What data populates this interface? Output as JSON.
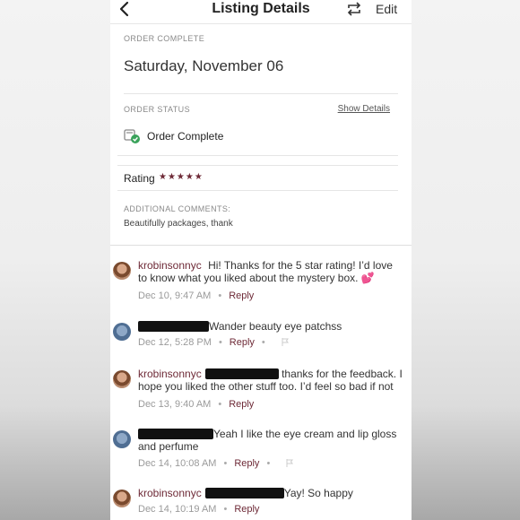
{
  "header": {
    "title": "Listing Details",
    "edit_label": "Edit"
  },
  "order": {
    "section_label": "ORDER COMPLETE",
    "date": "Saturday, November 06",
    "status_label": "ORDER STATUS",
    "show_details": "Show Details",
    "status_text": "Order Complete",
    "rating_label": "Rating",
    "rating_stars": "★★★★★",
    "rating_value": 5,
    "comments_label": "ADDITIONAL COMMENTS:",
    "comments_text": "Beautifully packages, thank"
  },
  "thread": [
    {
      "username": "krobinsonnyc",
      "line1": "Hi! Thanks for the 5 star rating! I’d love",
      "line2": "to know what you liked about the mystery box.",
      "emoji": "💕",
      "time": "Dec 10, 9:47 AM",
      "reply": "Reply"
    },
    {
      "text": "Wander beauty eye patchss",
      "time": "Dec 12, 5:28 PM",
      "reply": "Reply"
    },
    {
      "username": "krobinsonnyc",
      "line1": "thanks for the feedback. I",
      "line2": "hope you liked the other stuff too. I’d feel so bad if not",
      "time": "Dec 13, 9:40 AM",
      "reply": "Reply"
    },
    {
      "line1": "Yeah I like the eye cream and lip gloss",
      "line2": "and perfume",
      "time": "Dec 14, 10:08 AM",
      "reply": "Reply"
    },
    {
      "username": "krobinsonnyc",
      "line1": "Yay! So happy",
      "time": "Dec 14, 10:19 AM",
      "reply": "Reply"
    }
  ],
  "colors": {
    "accent": "#6e2a37",
    "status_green": "#3aa35b"
  },
  "icons": [
    "back-chevron",
    "repost-arrows",
    "order-complete-icon",
    "flag-icon"
  ]
}
